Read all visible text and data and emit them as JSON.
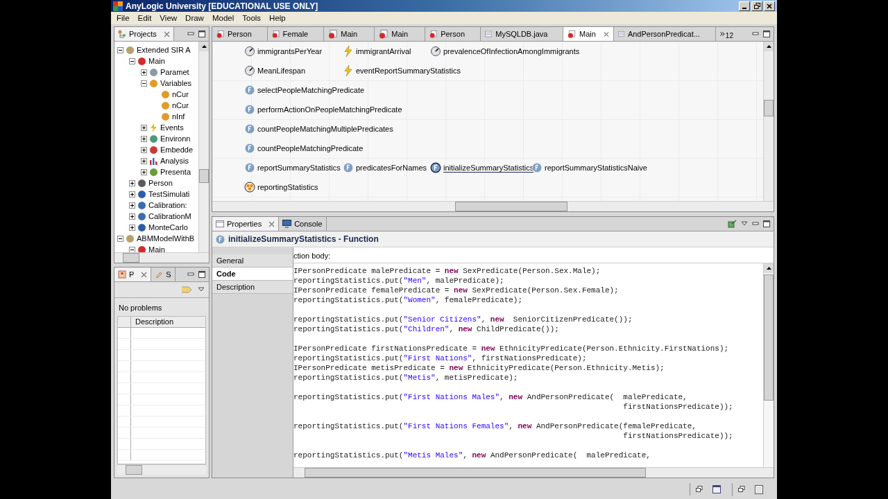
{
  "window": {
    "title": "AnyLogic University [EDUCATIONAL USE ONLY]"
  },
  "menu": [
    "File",
    "Edit",
    "View",
    "Draw",
    "Model",
    "Tools",
    "Help"
  ],
  "projects": {
    "tab": {
      "label": "Projects",
      "selected": true
    },
    "tree": [
      {
        "label": "Extended SIR A",
        "kind": "model",
        "expanded": true,
        "children": [
          {
            "label": "Main",
            "kind": "agent",
            "expanded": true,
            "children": [
              {
                "label": "Paramet",
                "kind": "parameters",
                "expanded": false
              },
              {
                "label": "Variables",
                "kind": "variables",
                "expanded": true,
                "children": [
                  {
                    "label": "nCur",
                    "kind": "variable"
                  },
                  {
                    "label": "nCur",
                    "kind": "variable"
                  },
                  {
                    "label": "nInf",
                    "kind": "variable"
                  }
                ]
              },
              {
                "label": "Events",
                "kind": "events",
                "expanded": false
              },
              {
                "label": "Environn",
                "kind": "environment",
                "expanded": false
              },
              {
                "label": "Embedde",
                "kind": "embedded",
                "expanded": false
              },
              {
                "label": "Analysis",
                "kind": "analysis",
                "expanded": false
              },
              {
                "label": "Presenta",
                "kind": "presentation",
                "expanded": false
              }
            ]
          },
          {
            "label": "Person",
            "kind": "agent_type",
            "expanded": false
          },
          {
            "label": "TestSimulati",
            "kind": "simulation",
            "expanded": false
          },
          {
            "label": "Calibration:",
            "kind": "calibration",
            "expanded": false
          },
          {
            "label": "CalibrationM",
            "kind": "calibration",
            "expanded": false
          },
          {
            "label": "MonteCarlo",
            "kind": "montecarlo",
            "expanded": false
          }
        ]
      },
      {
        "label": "ABMModelWithB",
        "kind": "model",
        "expanded": true,
        "children": [
          {
            "label": "Main",
            "kind": "agent",
            "expanded": true
          }
        ]
      }
    ]
  },
  "editor": {
    "tabs": [
      {
        "label": "Person",
        "kind": "agent",
        "selected": false
      },
      {
        "label": "Female",
        "kind": "agent",
        "selected": false
      },
      {
        "label": "Main",
        "kind": "agent",
        "selected": false
      },
      {
        "label": "Main",
        "kind": "agent",
        "selected": false
      },
      {
        "label": "Person",
        "kind": "agent",
        "selected": false
      },
      {
        "label": "MySQLDB.java",
        "kind": "java",
        "selected": false
      },
      {
        "label": "Main",
        "kind": "agent",
        "selected": true
      },
      {
        "label": "AndPersonPredicat...",
        "kind": "java",
        "selected": false
      }
    ],
    "overflow_count": "12",
    "canvas_rows": [
      [
        {
          "label": "immigrantsPerYear",
          "kind": "parameter",
          "selected": false
        },
        {
          "label": "immigrantArrival",
          "kind": "event",
          "selected": false
        },
        {
          "label": "prevalenceOfInfectionAmongImmigrants",
          "kind": "parameter",
          "selected": false
        }
      ],
      [
        {
          "label": "MeanLifespan",
          "kind": "parameter",
          "selected": false
        },
        {
          "label": "eventReportSummaryStatistics",
          "kind": "event",
          "selected": false
        }
      ],
      [
        {
          "label": "selectPeopleMatchingPredicate",
          "kind": "function",
          "selected": false
        }
      ],
      [
        {
          "label": "performActionOnPeopleMatchingPredicate",
          "kind": "function",
          "selected": false
        }
      ],
      [
        {
          "label": "countPeopleMatchingMultiplePredicates",
          "kind": "function",
          "selected": false
        }
      ],
      [
        {
          "label": "countPeopleMatchingPredicate",
          "kind": "function",
          "selected": false
        }
      ],
      [
        {
          "label": "reportSummaryStatistics",
          "kind": "function",
          "selected": false
        },
        {
          "label": "predicatesForNames",
          "kind": "function",
          "selected": false
        },
        {
          "label": "initializeSummaryStatistics",
          "kind": "function",
          "selected": true
        },
        {
          "label": "reportSummaryStatisticsNaive",
          "kind": "function",
          "selected": false
        }
      ],
      [
        {
          "label": "reportingStatistics",
          "kind": "collection",
          "selected": false
        }
      ]
    ]
  },
  "problems": {
    "tabs": [
      {
        "label": "P",
        "kind": "problems",
        "selected": true
      },
      {
        "label": "S",
        "kind": "search",
        "selected": false
      }
    ],
    "message": "No problems",
    "columns": [
      "Description"
    ]
  },
  "properties": {
    "tabs": [
      {
        "label": "Properties",
        "kind": "properties",
        "selected": true
      },
      {
        "label": "Console",
        "kind": "console",
        "selected": false
      }
    ],
    "title": "initializeSummaryStatistics - Function",
    "sections": [
      {
        "label": "General",
        "selected": false
      },
      {
        "label": "Code",
        "selected": true
      },
      {
        "label": "Description",
        "selected": false
      }
    ],
    "field_label": "ction body:",
    "code": [
      {
        "gap": false,
        "tokens": [
          {
            "kind": "plain",
            "text": "IPersonPredicate malePredicate = "
          },
          {
            "kind": "keyword",
            "text": "new"
          },
          {
            "kind": "plain",
            "text": " SexPredicate(Person.Sex.Male);"
          }
        ]
      },
      {
        "gap": false,
        "tokens": [
          {
            "kind": "plain",
            "text": "reportingStatistics.put("
          },
          {
            "kind": "string",
            "text": "\"Men\""
          },
          {
            "kind": "plain",
            "text": ", malePredicate);"
          }
        ]
      },
      {
        "gap": false,
        "tokens": [
          {
            "kind": "plain",
            "text": "IPersonPredicate femalePredicate = "
          },
          {
            "kind": "keyword",
            "text": "new"
          },
          {
            "kind": "plain",
            "text": " SexPredicate(Person.Sex.Female);"
          }
        ]
      },
      {
        "gap": false,
        "tokens": [
          {
            "kind": "plain",
            "text": "reportingStatistics.put("
          },
          {
            "kind": "string",
            "text": "\"Women\""
          },
          {
            "kind": "plain",
            "text": ", femalePredicate);"
          }
        ]
      },
      {
        "gap": true,
        "tokens": [
          {
            "kind": "plain",
            "text": "reportingStatistics.put("
          },
          {
            "kind": "string",
            "text": "\"Senior Citizens\""
          },
          {
            "kind": "plain",
            "text": ", "
          },
          {
            "kind": "keyword",
            "text": "new"
          },
          {
            "kind": "plain",
            "text": "  SeniorCitizenPredicate());"
          }
        ]
      },
      {
        "gap": false,
        "tokens": [
          {
            "kind": "plain",
            "text": "reportingStatistics.put("
          },
          {
            "kind": "string",
            "text": "\"Children\""
          },
          {
            "kind": "plain",
            "text": ", "
          },
          {
            "kind": "keyword",
            "text": "new"
          },
          {
            "kind": "plain",
            "text": " ChildPredicate());"
          }
        ]
      },
      {
        "gap": true,
        "tokens": [
          {
            "kind": "plain",
            "text": "IPersonPredicate firstNationsPredicate = "
          },
          {
            "kind": "keyword",
            "text": "new"
          },
          {
            "kind": "plain",
            "text": " EthnicityPredicate(Person.Ethnicity.FirstNations);"
          }
        ]
      },
      {
        "gap": false,
        "tokens": [
          {
            "kind": "plain",
            "text": "reportingStatistics.put("
          },
          {
            "kind": "string",
            "text": "\"First Nations\""
          },
          {
            "kind": "plain",
            "text": ", firstNationsPredicate);"
          }
        ]
      },
      {
        "gap": false,
        "tokens": [
          {
            "kind": "plain",
            "text": "IPersonPredicate metisPredicate = "
          },
          {
            "kind": "keyword",
            "text": "new"
          },
          {
            "kind": "plain",
            "text": " EthnicityPredicate(Person.Ethnicity.Metis);"
          }
        ]
      },
      {
        "gap": false,
        "tokens": [
          {
            "kind": "plain",
            "text": "reportingStatistics.put("
          },
          {
            "kind": "string",
            "text": "\"Metis\""
          },
          {
            "kind": "plain",
            "text": ", metisPredicate);"
          }
        ]
      },
      {
        "gap": true,
        "tokens": [
          {
            "kind": "plain",
            "text": "reportingStatistics.put("
          },
          {
            "kind": "string",
            "text": "\"First Nations Males\""
          },
          {
            "kind": "plain",
            "text": ", "
          },
          {
            "kind": "keyword",
            "text": "new"
          },
          {
            "kind": "plain",
            "text": " AndPersonPredicate(  malePredicate,"
          }
        ]
      },
      {
        "gap": false,
        "tokens": [
          {
            "kind": "plain",
            "text": "                                                                        firstNationsPredicate));"
          }
        ]
      },
      {
        "gap": true,
        "tokens": [
          {
            "kind": "plain",
            "text": "reportingStatistics.put("
          },
          {
            "kind": "string",
            "text": "\"First Nations Females\""
          },
          {
            "kind": "plain",
            "text": ", "
          },
          {
            "kind": "keyword",
            "text": "new"
          },
          {
            "kind": "plain",
            "text": " AndPersonPredicate(femalePredicate,"
          }
        ]
      },
      {
        "gap": false,
        "tokens": [
          {
            "kind": "plain",
            "text": "                                                                        firstNationsPredicate));"
          }
        ]
      },
      {
        "gap": true,
        "tokens": [
          {
            "kind": "plain",
            "text": "reportingStatistics.put("
          },
          {
            "kind": "string",
            "text": "\"Metis Males\""
          },
          {
            "kind": "plain",
            "text": ", "
          },
          {
            "kind": "keyword",
            "text": "new"
          },
          {
            "kind": "plain",
            "text": " AndPersonPredicate(  malePredicate,"
          }
        ]
      }
    ]
  }
}
